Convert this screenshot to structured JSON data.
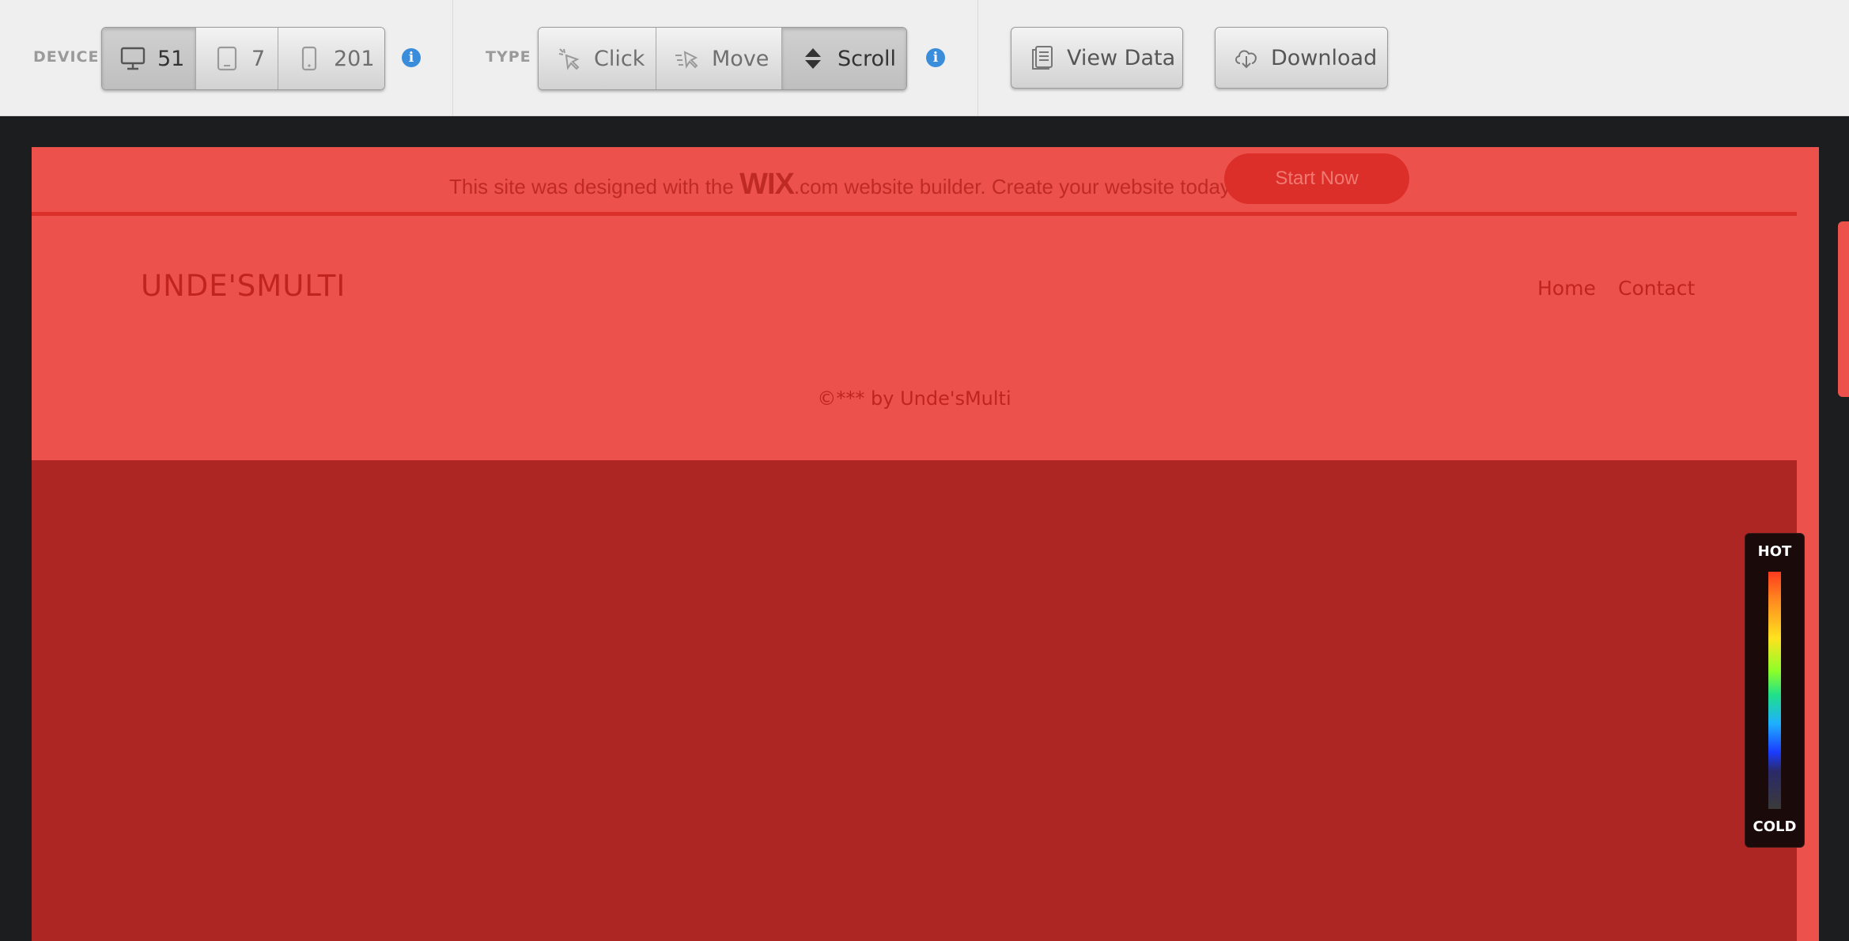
{
  "toolbar": {
    "device_label": "DEVICE",
    "devices": [
      {
        "icon": "desktop-icon",
        "count": "51",
        "active": true
      },
      {
        "icon": "tablet-icon",
        "count": "7",
        "active": false
      },
      {
        "icon": "mobile-icon",
        "count": "201",
        "active": false
      }
    ],
    "type_label": "TYPE",
    "types": [
      {
        "icon": "click-icon",
        "label": "Click",
        "active": false
      },
      {
        "icon": "move-icon",
        "label": "Move",
        "active": false
      },
      {
        "icon": "scroll-icon",
        "label": "Scroll",
        "active": true
      }
    ],
    "view_data_label": "View Data",
    "download_label": "Download",
    "info_glyph": "i"
  },
  "banner": {
    "text_before": "This site was designed with the ",
    "wix": "WIX",
    "text_after": ".com website builder. Create your website today.",
    "cta": "Start Now"
  },
  "site": {
    "title": "UNDE'SMULTI",
    "nav": [
      "Home",
      "Contact"
    ],
    "copyright": "©*** by Unde'sMulti"
  },
  "legend": {
    "hot": "HOT",
    "cold": "COLD"
  },
  "colors": {
    "page_bg": "#ec524b",
    "hot_region": "#ae2624",
    "accent": "#dd2f2a",
    "info": "#3a8ddb"
  }
}
